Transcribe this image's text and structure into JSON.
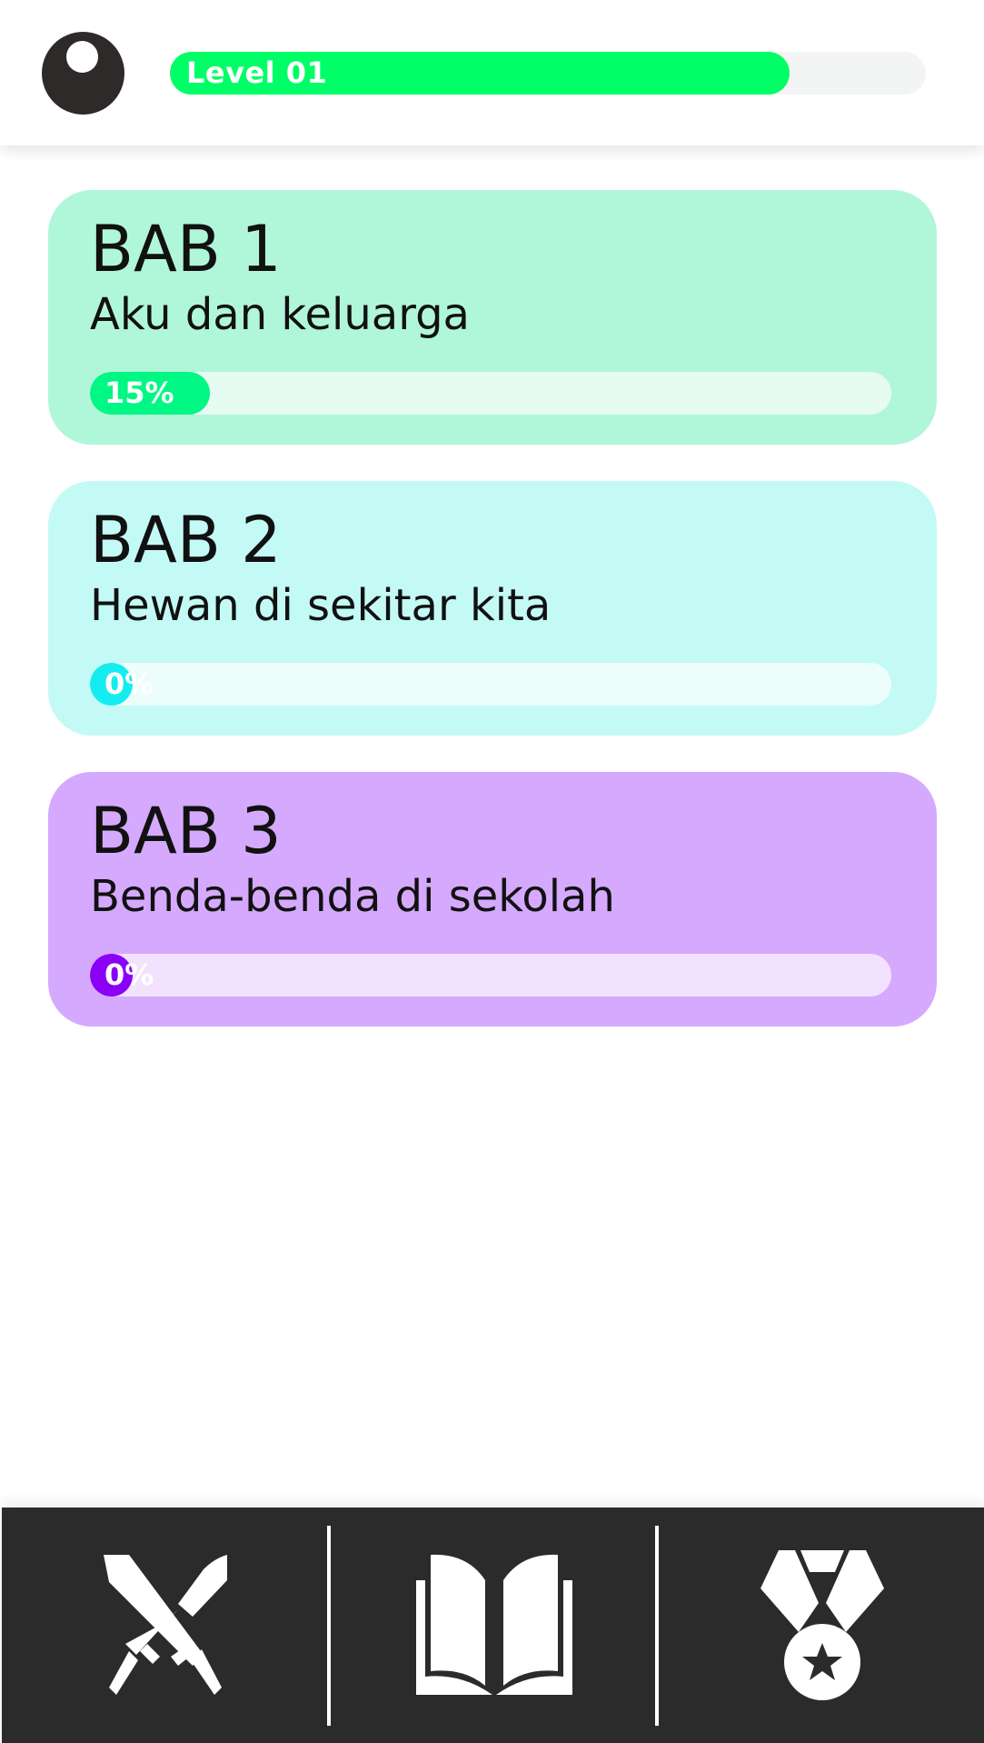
{
  "header": {
    "avatar_icon": "user-avatar-icon",
    "level_label": "Level 01",
    "level_progress": 0.82,
    "level_color": "#00ff66"
  },
  "chapters": [
    {
      "title": "BAB 1",
      "subtitle": "Aku dan keluarga",
      "progress_label": "15%",
      "progress": 0.15,
      "card_color": "#b0f7da",
      "track_color": "#e6fbf1",
      "fill_color": "#00f784"
    },
    {
      "title": "BAB 2",
      "subtitle": "Hewan di sekitar kita",
      "progress_label": "0%",
      "progress": 0,
      "card_color": "#c4faf6",
      "track_color": "#edfdfc",
      "fill_color": "#15ecf0"
    },
    {
      "title": "BAB 3",
      "subtitle": "Benda-benda di sekolah",
      "progress_label": "0%",
      "progress": 0,
      "card_color": "#d5a9fd",
      "track_color": "#f2e2fe",
      "fill_color": "#8a00f7"
    }
  ],
  "bottom_nav": {
    "items": [
      {
        "icon": "crossed-swords-icon"
      },
      {
        "icon": "open-book-icon"
      },
      {
        "icon": "medal-icon"
      }
    ]
  }
}
